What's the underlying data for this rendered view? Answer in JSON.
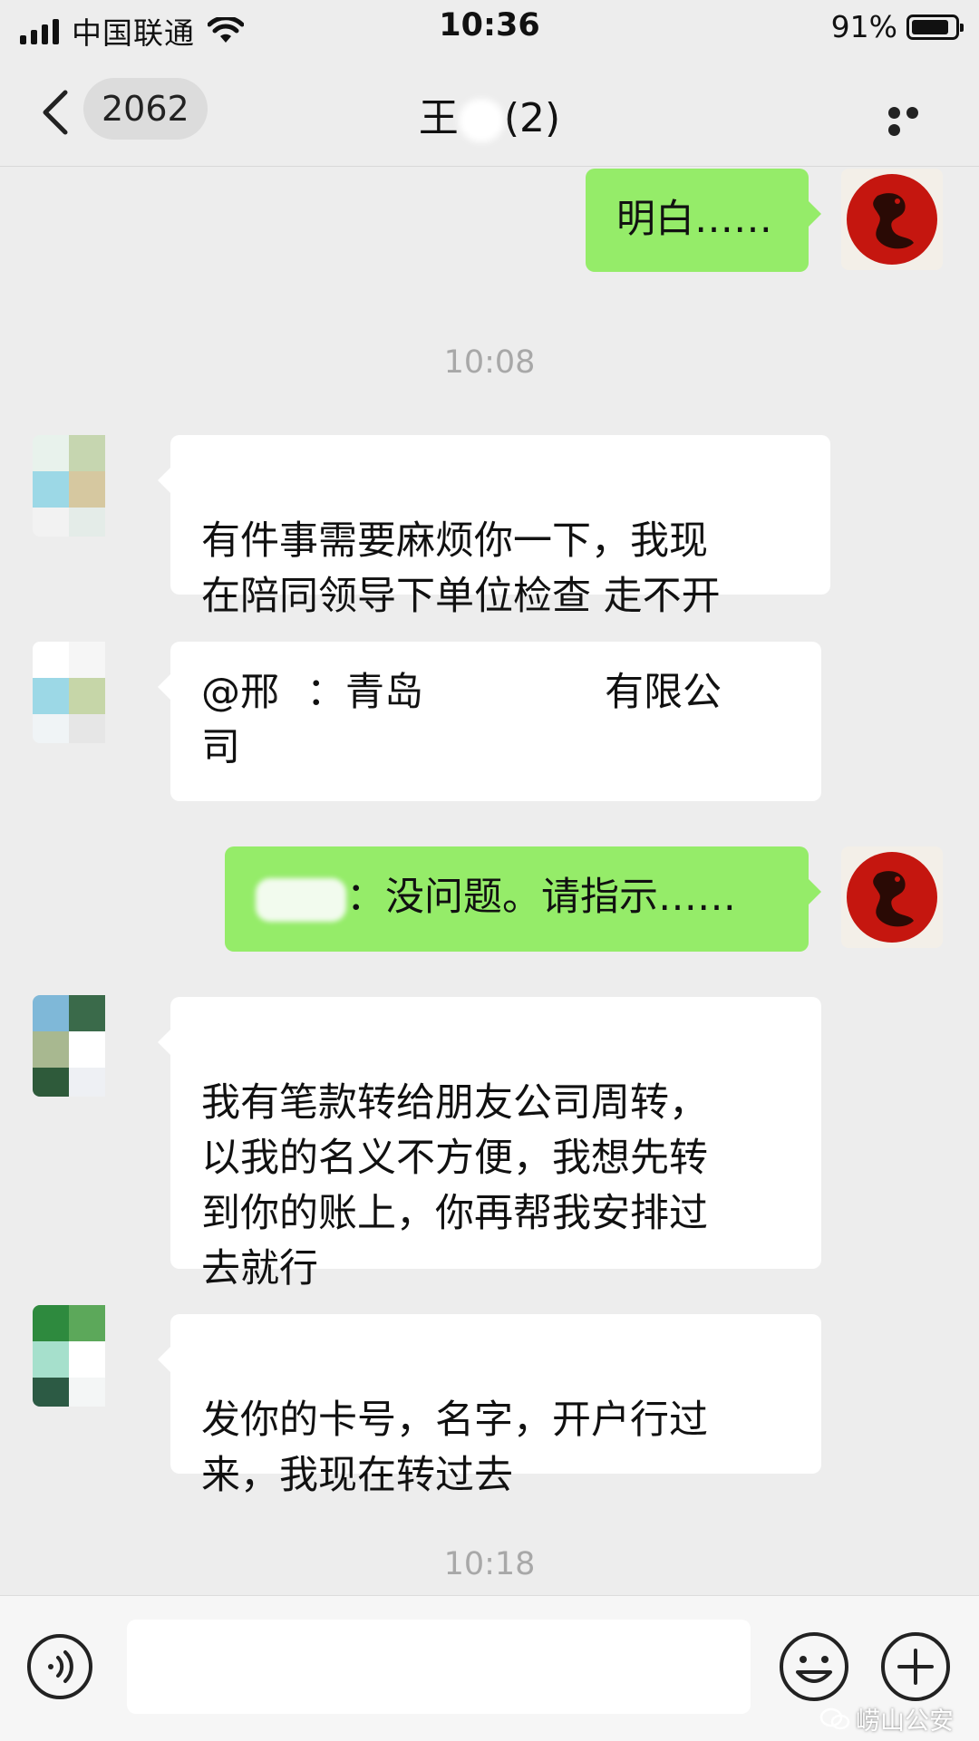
{
  "status_bar": {
    "carrier": "中国联通",
    "time": "10:36",
    "battery": "91%",
    "battery_level": 0.91
  },
  "nav": {
    "unread_count": "2062",
    "title_prefix": "王",
    "title_suffix": "(2)"
  },
  "messages": [
    {
      "text": "明白……"
    },
    {
      "time": "10:08"
    },
    {
      "text": "有件事需要麻烦你一下，我现\n在陪同领导下单位检查 走不开"
    },
    {
      "prefix": "@邢",
      "suffix_a": "：青岛",
      "suffix_b": "有限公\n司"
    },
    {
      "suffix": "：没问题。请指示……"
    },
    {
      "text": "我有笔款转给朋友公司周转，\n以我的名义不方便，我想先转\n到你的账上，你再帮我安排过\n去就行"
    },
    {
      "text": "发你的卡号，名字，开户行过\n来，我现在转过去"
    },
    {
      "time": "10:18"
    }
  ],
  "watermark": "崂山公安",
  "icons": {
    "back": "chevron-left-icon",
    "more": "more-dots-icon",
    "voice": "voice-icon",
    "emoji": "emoji-icon",
    "plus": "plus-circle-icon"
  },
  "colors": {
    "background": "#ededed",
    "outgoing_bubble": "#95ec69",
    "incoming_bubble": "#ffffff",
    "time_text": "#a8a8a8"
  }
}
